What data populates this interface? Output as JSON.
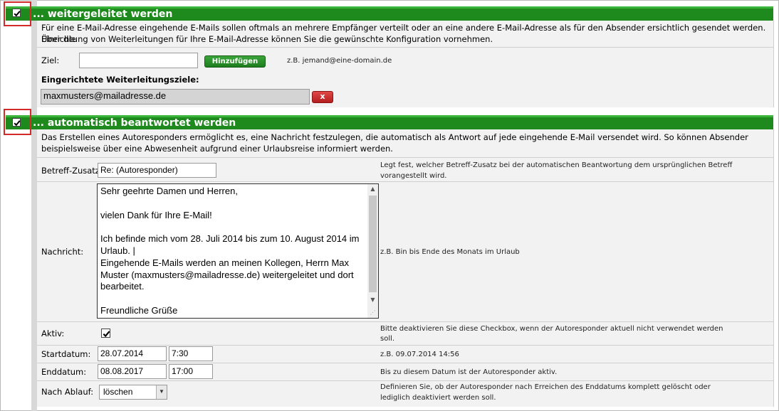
{
  "forward": {
    "title": "... weitergeleitet werden",
    "checked": true,
    "desc_line1": "Für eine E-Mail-Adresse eingehende E-Mails sollen oftmals an mehrere Empfänger verteilt oder an eine andere E-Mail-Adresse als für den Absender ersichtlich gesendet werden. Über die",
    "desc_line2": "Einrichtung von Weiterleitungen für Ihre E-Mail-Adresse können Sie die gewünschte Konfiguration vornehmen.",
    "target_label": "Ziel:",
    "target_value": "",
    "add_button": "Hinzufügen",
    "example": "z.B. jemand@eine-domain.de",
    "configured_label": "Eingerichtete Weiterleitungsziele:",
    "configured_value": "maxmusters@mailadresse.de",
    "remove_button": "x"
  },
  "autoreply": {
    "title": "... automatisch beantwortet werden",
    "checked": true,
    "desc_line1": "Das Erstellen eines Autoresponders ermöglicht es, eine Nachricht festzulegen, die automatisch als Antwort auf jede eingehende E-Mail versendet wird. So können Absender",
    "desc_line2": "beispielsweise über eine Abwesenheit aufgrund einer Urlaubsreise informiert werden.",
    "subject_label": "Betreff-Zusatz:",
    "subject_value": "Re: (Autoresponder)",
    "subject_help_line1": "Legt fest, welcher Betreff-Zusatz bei der automatischen Beantwortung dem ursprünglichen Betreff",
    "subject_help_line2": "vorangestellt wird.",
    "message_label": "Nachricht:",
    "message_value": "Sehr geehrte Damen und Herren,\n\nvielen Dank für Ihre E-Mail!\n\nIch befinde mich vom 28. Juli 2014 bis zum 10. August 2014 im Urlaub. |\nEingehende E-Mails werden an meinen Kollegen, Herrn Max Muster (maxmusters@mailadresse.de) weitergeleitet und dort bearbeitet.\n\nFreundliche Grüße",
    "message_help": "z.B. Bin bis Ende des Monats im Urlaub",
    "active_label": "Aktiv:",
    "active_checked": true,
    "active_help_line1": "Bitte deaktivieren Sie diese Checkbox, wenn der Autoresponder aktuell nicht verwendet werden",
    "active_help_line2": "soll.",
    "start_label": "Startdatum:",
    "start_date": "28.07.2014",
    "start_time": "7:30",
    "start_help": "z.B. 09.07.2014 14:56",
    "end_label": "Enddatum:",
    "end_date": "08.08.2017",
    "end_time": "17:00",
    "end_help": "Bis zu diesem Datum ist der Autoresponder aktiv.",
    "expiry_label": "Nach Ablauf:",
    "expiry_value": "löschen",
    "expiry_help_line1": "Definieren Sie, ob der Autoresponder nach Erreichen des Enddatums komplett gelöscht oder",
    "expiry_help_line2": "lediglich deaktiviert werden soll."
  },
  "colors": {
    "header_green": "#1e8a1e",
    "highlight_red": "#d42a2a",
    "remove_red": "#c62828"
  },
  "icons": [
    "checkmark-icon",
    "scroll-up-arrow-icon",
    "scroll-down-arrow-icon",
    "resize-grip-icon",
    "chevron-down-icon"
  ]
}
